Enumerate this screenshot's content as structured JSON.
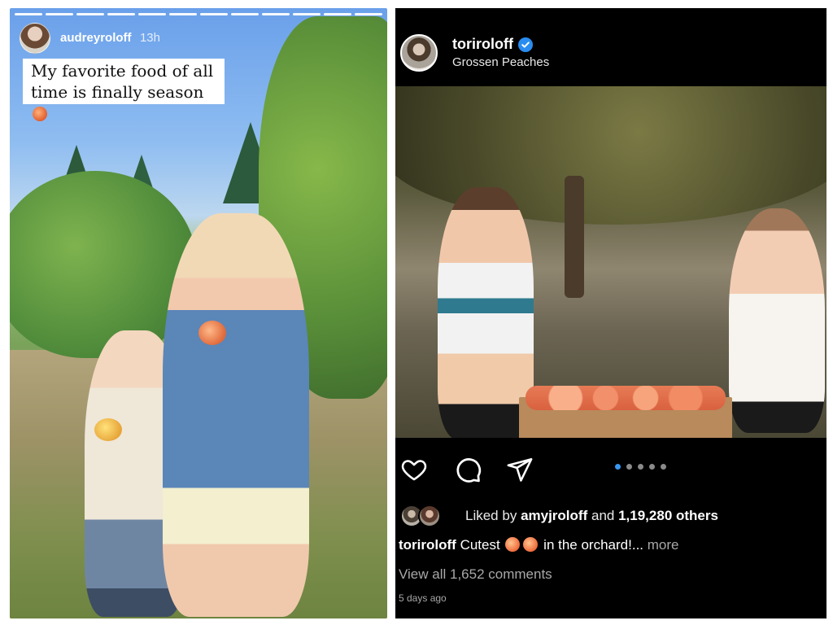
{
  "story": {
    "username": "audreyroloff",
    "time": "13h",
    "caption": "My favorite food of all time is finally season",
    "caption_emoji": "peach-icon",
    "progress_segments_total": 12,
    "progress_segments_viewed": 12
  },
  "post": {
    "username": "toriroloff",
    "verified": true,
    "location": "Grossen Peaches",
    "carousel_total": 5,
    "carousel_index": 1,
    "liked_by_prefix": "Liked by",
    "liked_by_user": "amyjroloff",
    "liked_by_and": "and",
    "liked_count": "1,19,280 others",
    "caption_user": "toriroloff",
    "caption_text_before": "Cutest",
    "caption_text_after": "in the orchard!...",
    "caption_more": "more",
    "view_comments": "View all 1,652 comments",
    "time_ago": "5 days ago"
  },
  "colors": {
    "verified_blue": "#2a8cf0",
    "carousel_active": "#3797f0",
    "muted_text": "#a8a8a8",
    "post_bg": "#000000"
  }
}
